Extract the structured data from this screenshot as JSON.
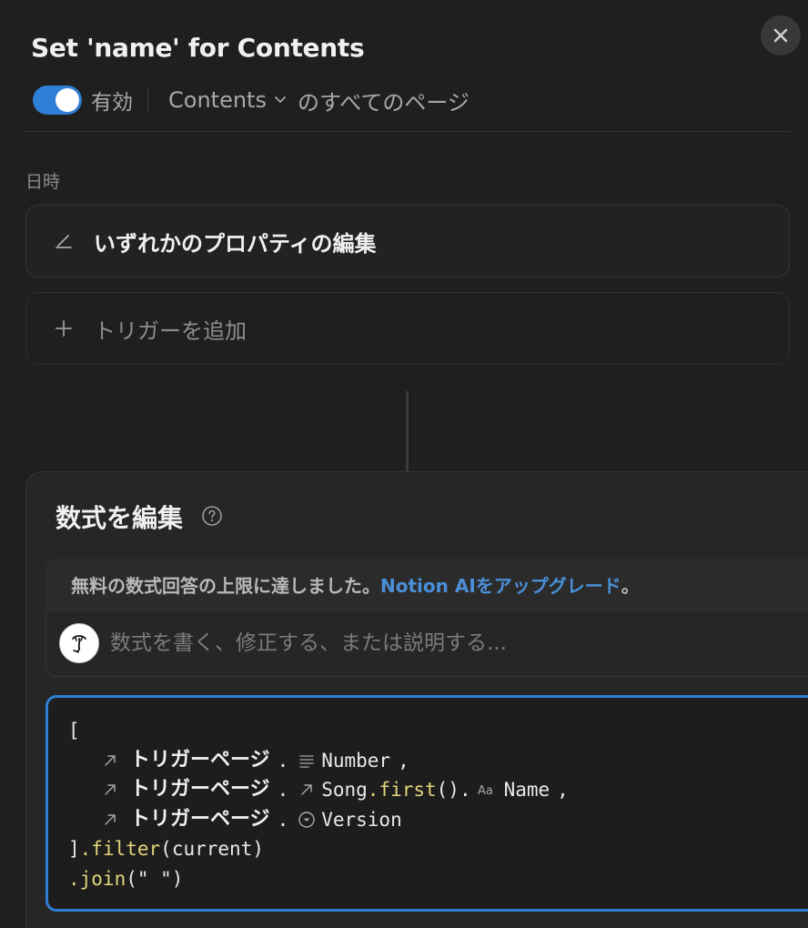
{
  "header": {
    "title": "Set 'name' for Contents",
    "close_icon": "close-icon"
  },
  "status": {
    "enabled": true,
    "enabled_label": "有効",
    "scope_database": "Contents",
    "scope_rest": "のすべてのページ"
  },
  "trigger_section": {
    "label": "日時",
    "trigger_text": "いずれかのプロパティの編集",
    "trigger_icon": "edit-icon",
    "add_trigger_text": "トリガーを追加",
    "add_icon": "plus-icon"
  },
  "formula": {
    "title": "数式を編集",
    "help_icon": "help-circle-icon",
    "notice_text": "無料の数式回答の上限に達しました。",
    "notice_link": "Notion AIをアップグレード",
    "notice_end": "。",
    "ai_placeholder": "数式を書く、修正する、または説明する...",
    "code": {
      "line1": "[",
      "line2_ref": "トリガーページ",
      "line2_dot": ".",
      "line2_prop": "Number",
      "line2_comma": ",",
      "line3_ref": "トリガーページ",
      "line3_dot": ".",
      "line3_prop": "Song",
      "line3_fn": ".first",
      "line3_parens": "().",
      "line3_prop2": "Name",
      "line3_comma": ",",
      "line4_ref": "トリガーページ",
      "line4_dot": ".",
      "line4_prop": "Version",
      "line5_bracket": "]",
      "line5_fn": ".filter",
      "line5_args": "(current)",
      "line6_fn": ".join",
      "line6_args": "(\" \")"
    }
  },
  "colors": {
    "accent": "#2f7fd6",
    "link": "#4b8fd9",
    "function": "#e2d57a",
    "background": "#1f1f1f"
  }
}
